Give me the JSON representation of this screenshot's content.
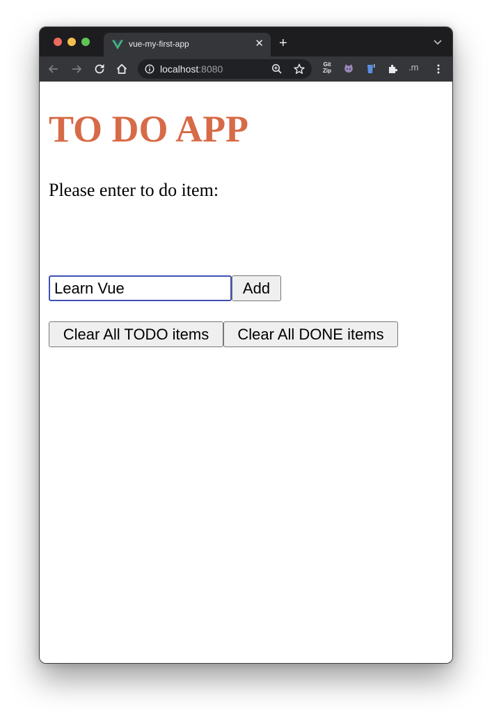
{
  "browser": {
    "tab_title": "vue-my-first-app",
    "tab_close": "✕",
    "new_tab": "+",
    "url_host": "localhost",
    "url_port": ":8080",
    "extension_gitzip_line1": "Git",
    "extension_gitzip_line2": "Zip",
    "extension_m": ".m",
    "favicon_color": "#42b883",
    "tabbar_color": "#1d1d20",
    "toolbar_color": "#35363a"
  },
  "app": {
    "title": "TO DO APP",
    "title_color": "#d76b47",
    "prompt": "Please enter to do item:",
    "input_value": "Learn Vue",
    "add_label": "Add",
    "clear_todo_label": "Clear All TODO items",
    "clear_done_label": "Clear All DONE items"
  }
}
